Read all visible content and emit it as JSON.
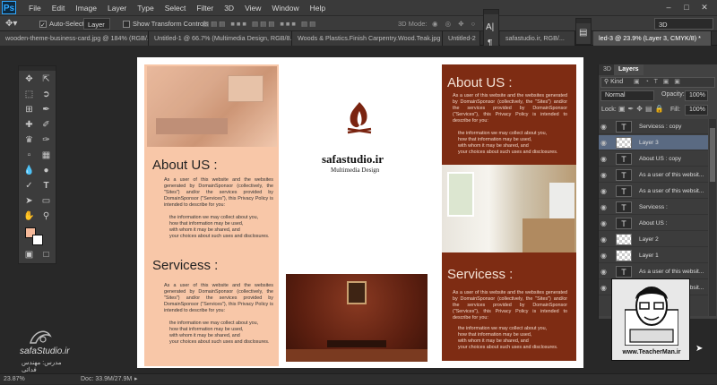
{
  "menu": {
    "logo": "Ps",
    "items": [
      "File",
      "Edit",
      "Image",
      "Layer",
      "Type",
      "Select",
      "Filter",
      "3D",
      "View",
      "Window",
      "Help"
    ],
    "workspace": "3D"
  },
  "options": {
    "auto_select_label": "Auto-Select:",
    "auto_select_value": "Layer",
    "show_transform_label": "Show Transform Controls",
    "mode_3d_label": "3D Mode:"
  },
  "tabs": [
    "wooden-theme-business-card.jpg @ 184% (RGB/...",
    "Untitled-1 @ 66.7% (Multimedia Design, RGB/8...",
    "Woods & Plastics.Finish Carpentry.Wood.Teak.jpg",
    "Untitled-2",
    "safastudio.ir, RGB/...",
    "led-3 @ 23.9% (Layer 3, CMYK/8) *"
  ],
  "layers_panel": {
    "tab_3d": "3D",
    "tab_layers": "Layers",
    "filter_kind": "Kind",
    "blend_mode": "Normal",
    "opacity_label": "Opacity:",
    "opacity_value": "100%",
    "lock_label": "Lock:",
    "fill_label": "Fill:",
    "fill_value": "100%",
    "layers": [
      {
        "name": "Servicess : copy",
        "kind": "T"
      },
      {
        "name": "Layer 3",
        "kind": "img"
      },
      {
        "name": "About US : copy",
        "kind": "T"
      },
      {
        "name": "As a user of this websit...",
        "kind": "T"
      },
      {
        "name": "As a user of this websit...",
        "kind": "T"
      },
      {
        "name": "Servicess :",
        "kind": "T"
      },
      {
        "name": "About US :",
        "kind": "T"
      },
      {
        "name": "Layer 2",
        "kind": "img"
      },
      {
        "name": "Layer 1",
        "kind": "img"
      },
      {
        "name": "As a user of this websit...",
        "kind": "T"
      },
      {
        "name": "As a user of this websit...",
        "kind": "T"
      }
    ]
  },
  "status": {
    "zoom": "23.87%",
    "doc": "Doc: 33.9M/27.9M"
  },
  "brochure": {
    "logo_name": "safastudio.ir",
    "logo_tagline": "Multimedia Design",
    "about_title": "About US :",
    "services_title": "Servicess :",
    "para_1": "As a user of this website and the websites generated by DomainSponsor (collectively, the \"Sites\") and/or the services provided by DomainSponsor (\"Services\"), this Privacy Policy is intended to describe for you:",
    "para_2": "the information we may collect about you,\nhow that information may be used,\nwith whom it may be shared, and\nyour choices about such uses and disclosures."
  },
  "watermarks": {
    "left_name": "safaStudio.ir",
    "left_sub": "مدرس: مهندس فدائی",
    "right_url": "www.TeacherMan.ir"
  },
  "mini_panel": {
    "char_icon": "A|",
    "para_icon": "¶"
  }
}
